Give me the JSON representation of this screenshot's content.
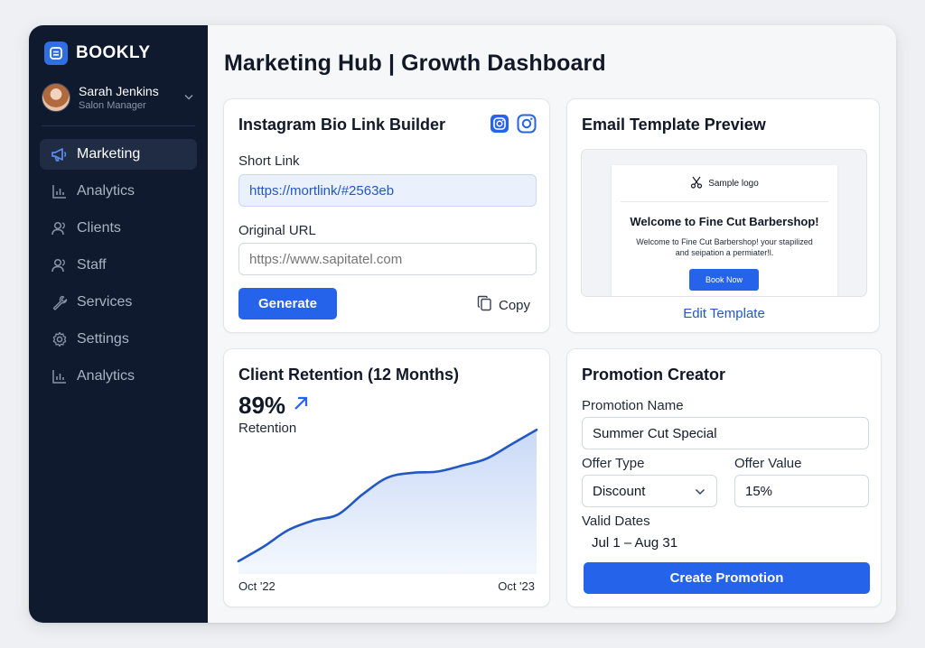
{
  "brand": {
    "name": "BOOKLY"
  },
  "user": {
    "name": "Sarah Jenkins",
    "role": "Salon Manager"
  },
  "nav": {
    "items": [
      {
        "label": "Marketing",
        "icon": "megaphone-icon",
        "active": true
      },
      {
        "label": "Analytics",
        "icon": "bar-chart-icon"
      },
      {
        "label": "Clients",
        "icon": "clients-icon"
      },
      {
        "label": "Staff",
        "icon": "staff-icon"
      },
      {
        "label": "Services",
        "icon": "wrench-icon"
      },
      {
        "label": "Settings",
        "icon": "gear-icon"
      },
      {
        "label": "Analytics",
        "icon": "bar-chart-icon"
      }
    ]
  },
  "page": {
    "title": "Marketing Hub | Growth Dashboard"
  },
  "instagram": {
    "title": "Instagram Bio Link Builder",
    "short_link_label": "Short Link",
    "short_link_value": "https://mortlink/#2563eb",
    "original_url_label": "Original URL",
    "original_url_placeholder": "https://www.sapitatel.com",
    "generate_label": "Generate",
    "copy_label": "Copy"
  },
  "email": {
    "title": "Email Template Preview",
    "logo_text": "Sample logo",
    "heading": "Welcome to Fine Cut Barbershop!",
    "body_line1": "Welcome to Fine Cut Barbershop! your stapilized",
    "body_line2": "and seipation a permiater!l.",
    "button_label": "Book Now",
    "edit_label": "Edit Template"
  },
  "retention": {
    "title": "Client Retention (12 Months)",
    "value": "89%",
    "value_label": "Retention",
    "x_start": "Oct '22",
    "x_end": "Oct '23"
  },
  "promotion": {
    "title": "Promotion Creator",
    "name_label": "Promotion Name",
    "name_value": "Summer Cut Special",
    "offer_type_label": "Offer Type",
    "offer_type_value": "Discount",
    "offer_value_label": "Offer Value",
    "offer_value_value": "15%",
    "dates_label": "Valid Dates",
    "dates_value": "Jul 1 – Aug 31",
    "create_label": "Create Promotion"
  },
  "chart_data": {
    "type": "area",
    "xlabel": "",
    "ylabel": "",
    "x": [
      "Oct '22",
      "Oct '23"
    ],
    "values": [
      10,
      22,
      36,
      44,
      49,
      66,
      80,
      84,
      85,
      90,
      96,
      108,
      120
    ],
    "ylim": [
      0,
      130
    ],
    "grid": false,
    "colors": {
      "line": "#2358c4",
      "fill": "#dbe6fb"
    }
  },
  "colors": {
    "sidebar": "#0f1a2e",
    "accent": "#2563eb",
    "active_nav": "#1f2c44"
  }
}
